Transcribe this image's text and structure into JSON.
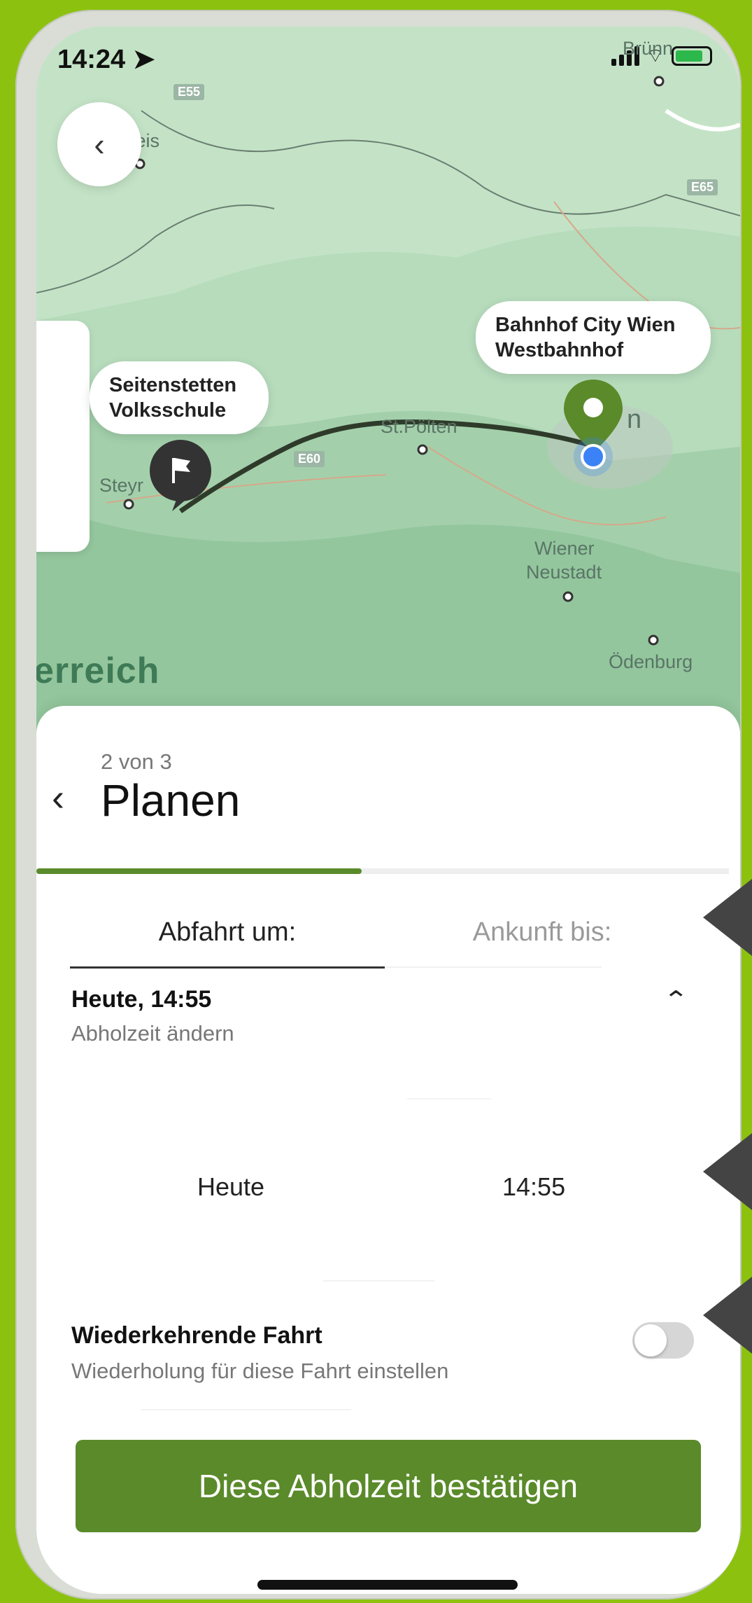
{
  "colors": {
    "outer_background": "#8cc20f",
    "brand_green": "#5a8a2a",
    "map_green": "#a9d7b3",
    "route_line": "#2f3b2a",
    "marker_dark": "#333333",
    "location_blue": "#3b82f6"
  },
  "status_bar": {
    "time": "14:24",
    "location_icon": "location-arrow-icon",
    "signal_icon": "signal-bars-icon",
    "wifi_icon": "wifi-icon",
    "battery_icon": "battery-charging-icon"
  },
  "map": {
    "back_icon": "chevron-left-icon",
    "destination_bubble": {
      "line1": "Bahnhof City Wien",
      "line2": "Westbahnhof"
    },
    "origin_bubble": {
      "line1": "Seitenstetten",
      "line2": "Volksschule"
    },
    "place_labels": {
      "veis": "veis",
      "steyr": "Steyr",
      "st_poelten": "St.Pölten",
      "wiener_neustadt_1": "Wiener",
      "wiener_neustadt_2": "Neustadt",
      "oedenburg": "Ödenburg",
      "bruenn": "Brünn",
      "wien": "n",
      "oesterreich": "erreich"
    },
    "road_labels": {
      "e55": "E55",
      "e65": "E65",
      "e60": "E60"
    }
  },
  "sheet": {
    "step": "2 von 3",
    "title": "Planen",
    "back_icon": "chevron-left-icon",
    "progress_fraction": 0.5,
    "tabs": {
      "departure": "Abfahrt um:",
      "arrival": "Ankunft bis:"
    },
    "pickup": {
      "title": "Heute, 14:55",
      "subtitle": "Abholzeit ändern",
      "chevron_icon": "chevron-up-icon"
    },
    "picker": {
      "day": "Heute",
      "time": "14:55"
    },
    "recurring": {
      "title": "Wiederkehrende Fahrt",
      "subtitle": "Wiederholung für diese Fahrt einstellen",
      "enabled": false
    },
    "confirm_button": "Diese Abholzeit bestätigen"
  }
}
